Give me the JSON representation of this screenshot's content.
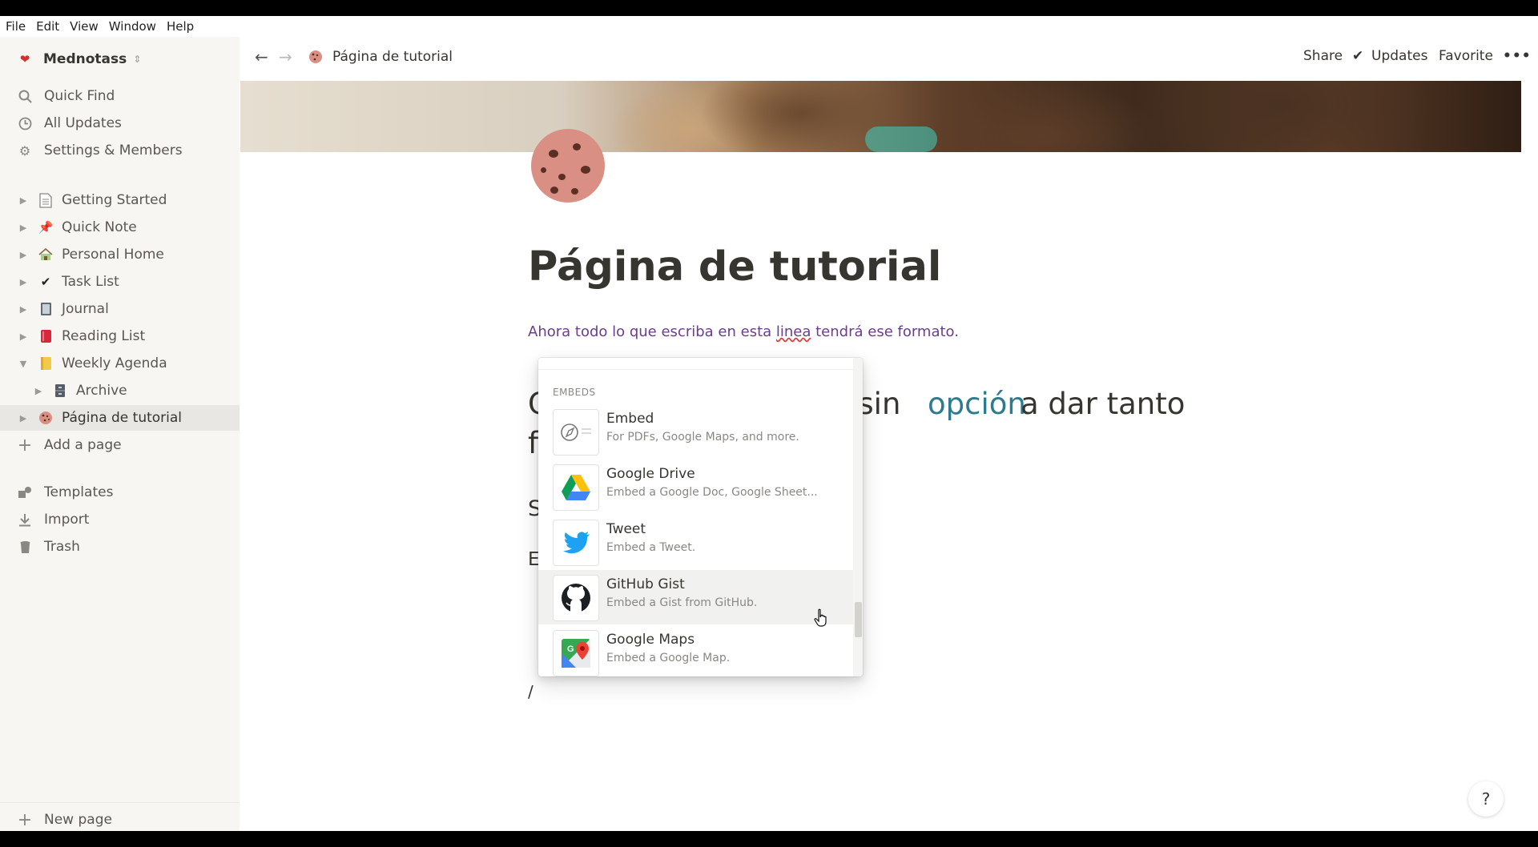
{
  "menubar": {
    "file": "File",
    "edit": "Edit",
    "view": "View",
    "window": "Window",
    "help": "Help"
  },
  "workspace": {
    "name": "Mednotass"
  },
  "sidebar": {
    "quick_find": "Quick Find",
    "all_updates": "All Updates",
    "settings": "Settings & Members",
    "pages": [
      {
        "label": "Getting Started",
        "icon": "page-icon"
      },
      {
        "label": "Quick Note",
        "icon": "pushpin-icon"
      },
      {
        "label": "Personal Home",
        "icon": "house-icon"
      },
      {
        "label": "Task List",
        "icon": "checkmark-icon"
      },
      {
        "label": "Journal",
        "icon": "notebook-icon"
      },
      {
        "label": "Reading List",
        "icon": "book-icon"
      },
      {
        "label": "Weekly Agenda",
        "icon": "notebook-yellow-icon"
      },
      {
        "label": "Archive",
        "icon": "cabinet-icon"
      },
      {
        "label": "Página de tutorial",
        "icon": "cookie-icon"
      }
    ],
    "add_page": "Add a page",
    "templates": "Templates",
    "import": "Import",
    "trash": "Trash",
    "new_page": "New page"
  },
  "header": {
    "breadcrumb": "Página de tutorial",
    "share": "Share",
    "updates": "Updates",
    "favorite": "Favorite",
    "more": "•••"
  },
  "page": {
    "title": "Página de tutorial",
    "line1_a": "Ahora todo lo que escriba en esta ",
    "line1_err": "linea",
    "line1_b": " tendrá ese formato.",
    "heading_start": "C",
    "heading_mid": "o sin ",
    "heading_blue": "opción",
    "heading_end": " a dar tanto",
    "frag_f": "f",
    "frag_s": "S",
    "frag_e": "E",
    "slash": "/"
  },
  "embed_menu": {
    "section": "EMBEDS",
    "items": [
      {
        "title": "Embed",
        "subtitle": "For PDFs, Google Maps, and more.",
        "icon": "compass-embed-icon"
      },
      {
        "title": "Google Drive",
        "subtitle": "Embed a Google Doc, Google Sheet...",
        "icon": "google-drive-icon"
      },
      {
        "title": "Tweet",
        "subtitle": "Embed a Tweet.",
        "icon": "twitter-bird-icon"
      },
      {
        "title": "GitHub Gist",
        "subtitle": "Embed a Gist from GitHub.",
        "icon": "github-icon"
      },
      {
        "title": "Google Maps",
        "subtitle": "Embed a Google Map.",
        "icon": "google-maps-icon"
      }
    ]
  },
  "help": {
    "label": "?"
  },
  "colors": {
    "sidebar_bg": "#f7f6f3",
    "text": "#37352f",
    "accent_purple": "#6b3d8c",
    "accent_blue": "#2e7b8f"
  }
}
